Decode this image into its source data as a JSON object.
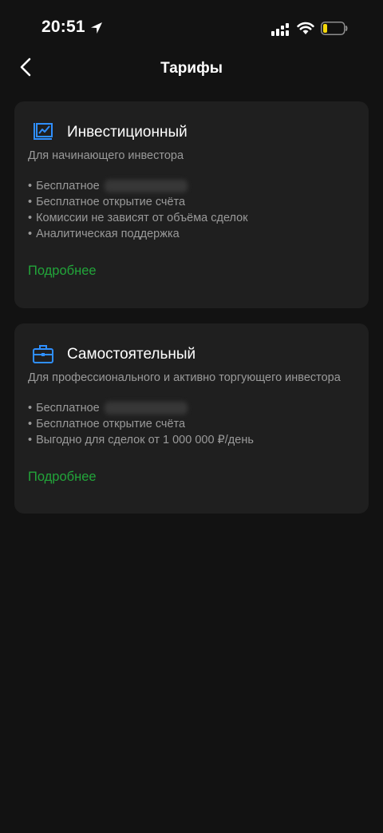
{
  "status_bar": {
    "time": "20:51",
    "icons": [
      "location-arrow-icon",
      "cellular-signal-icon",
      "wifi-icon",
      "battery-icon"
    ]
  },
  "nav": {
    "back_icon": "chevron-left-icon",
    "title": "Тарифы"
  },
  "colors": {
    "background": "#121212",
    "card": "#1f1f1f",
    "accent_link": "#22a53a",
    "icon_blue": "#2f8fff",
    "secondary_text": "#9a9a9a",
    "battery_level": "#f5d90a"
  },
  "battery_level_fraction": 0.15,
  "tariffs": [
    {
      "icon": "chart-icon",
      "title": "Инвестиционный",
      "subtitle": "Для начинающего инвестора",
      "features": [
        {
          "text": "Бесплатное",
          "blurred": true
        },
        {
          "text": "Бесплатное открытие счёта",
          "blurred": false
        },
        {
          "text": "Комиссии не зависят от объёма сделок",
          "blurred": false
        },
        {
          "text": "Аналитическая поддержка",
          "blurred": false
        }
      ],
      "link": "Подробнее"
    },
    {
      "icon": "briefcase-icon",
      "title": "Самостоятельный",
      "subtitle": "Для профессионального и активно торгующего инвестора",
      "features": [
        {
          "text": "Бесплатное",
          "blurred": true
        },
        {
          "text": "Бесплатное открытие счёта",
          "blurred": false
        },
        {
          "text": "Выгодно для сделок от 1 000 000 ₽/день",
          "blurred": false
        }
      ],
      "link": "Подробнее"
    }
  ]
}
